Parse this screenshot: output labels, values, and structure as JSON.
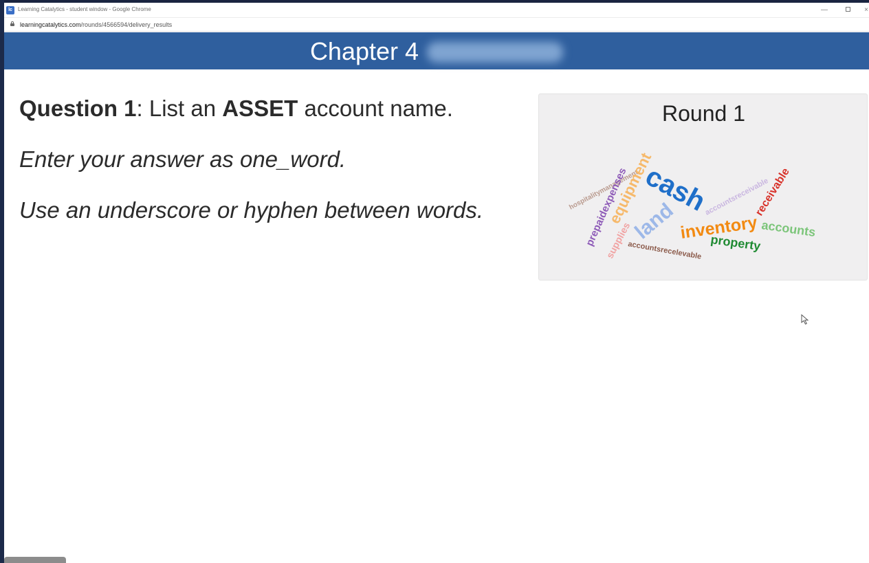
{
  "window": {
    "title": "Learning Catalytics - student window - Google Chrome",
    "icon_text": "lc",
    "controls": {
      "minimize": "—",
      "close": "×"
    }
  },
  "address_bar": {
    "url_host": "learningcatalytics.com",
    "url_path": "/rounds/4566594/delivery_results"
  },
  "header": {
    "title": "Chapter 4",
    "color": "#2f5f9e"
  },
  "question": {
    "label": "Question 1",
    "separator": ":",
    "prefix": " List an ",
    "bold_word": "ASSET",
    "suffix": " account name.",
    "instruction_1": "Enter your answer as one_word.",
    "instruction_2": "Use an underscore or hyphen between words."
  },
  "results": {
    "round_title": "Round 1",
    "words": [
      {
        "text": "cash",
        "color": "#1f6fc9"
      },
      {
        "text": "inventory",
        "color": "#f28a12"
      },
      {
        "text": "property",
        "color": "#1f8a32"
      },
      {
        "text": "accounts",
        "color": "#7cc57a"
      },
      {
        "text": "receivable",
        "color": "#d8322a"
      },
      {
        "text": "land",
        "color": "#9db8e8"
      },
      {
        "text": "equipment",
        "color": "#f6b96b"
      },
      {
        "text": "prepaidexpenses",
        "color": "#8e5bb8"
      },
      {
        "text": "supplies",
        "color": "#f1a3a3"
      },
      {
        "text": "accountsreceivable",
        "color": "#c9b6e0"
      },
      {
        "text": "accountsrecelevable",
        "color": "#8b5a4a"
      },
      {
        "text": "hospitalitymanagement",
        "color": "#b99a8e"
      }
    ]
  }
}
